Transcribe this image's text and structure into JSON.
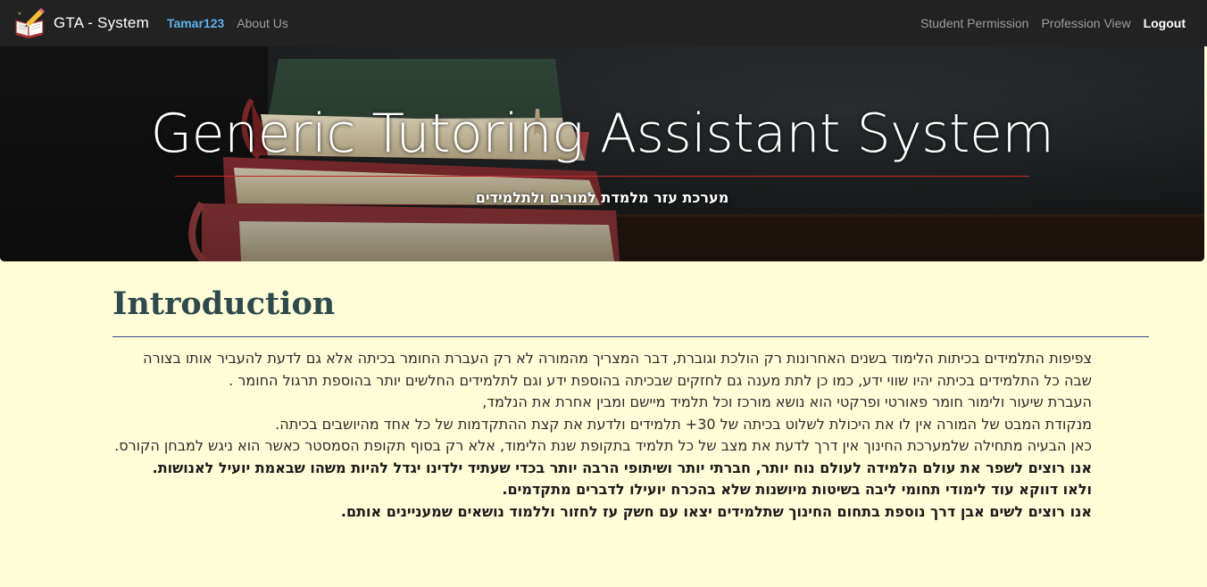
{
  "navbar": {
    "brand": "GTA - System",
    "username": "Tamar123",
    "about": "About Us",
    "right_links": [
      "Student Permission",
      "Profession View"
    ],
    "logout": "Logout"
  },
  "hero": {
    "title": "Generic Tutoring Assistant System",
    "subtitle": "מערכת עזר מלמדת למורים ולתלמידים"
  },
  "intro": {
    "heading": "Introduction",
    "paragraphs": [
      {
        "text": "צפיפות התלמידים בכיתות הלימוד בשנים האחרונות רק הולכת וגוברת, דבר המצריך מהמורה לא רק העברת החומר בכיתה אלא גם לדעת להעביר אותו בצורה שבה כל התלמידים בכיתה יהיו שווי ידע, כמו כן לתת מענה גם לחזקים שבכיתה בהוספת ידע וגם לתלמידים החלשים יותר בהוספת תרגול החומר .",
        "bold": false
      },
      {
        "text": "העברת שיעור ולימור חומר פאורטי ופרקטי הוא נושא מורכז וכל תלמיד מיישם ומבין אחרת את הנלמד,",
        "bold": false
      },
      {
        "text": "מנקודת המבט של המורה אין לו את היכולת לשלוט בכיתה של 30+ תלמידים ולדעת את קצת ההתקדמות של כל אחד מהיושבים בכיתה.",
        "bold": false
      },
      {
        "text": "כאן הבעיה מתחילה שלמערכת החינוך אין דרך לדעת את מצב של כל תלמיד בתקופת שנת הלימוד, אלא רק בסוף תקופת הסמסטר כאשר הוא ניגש למבחן הקורס.",
        "bold": false
      },
      {
        "text": "אנו רוצים לשפר את עולם הלמידה לעולם נוח יותר, חברתי יותר ושיתופי הרבה יותר בכדי שעתיד ילדינו יגדל להיות משהו שבאמת יועיל לאנושות.",
        "bold": true
      },
      {
        "text": "ולאו דווקא עוד לימודי תחומי ליבה בשיטות מיושנות שלא בהכרח יועילו לדברים מתקדמים.",
        "bold": true
      },
      {
        "text": "אנו רוצים לשים אבן דרך נוספת בתחום החינוך שתלמידים יצאו עם חשק עז לחזור וללמוד נושאים שמעניינים אותם.",
        "bold": true
      }
    ]
  },
  "colors": {
    "navbar_bg": "#222222",
    "username": "#5fb0ea",
    "page_bg": "#fffcd8",
    "heading": "#2f4a4d",
    "hero_rule": "#c62828",
    "intro_rule": "#3b4a8a"
  },
  "icons": {
    "brand": "book-pencil-icon"
  }
}
